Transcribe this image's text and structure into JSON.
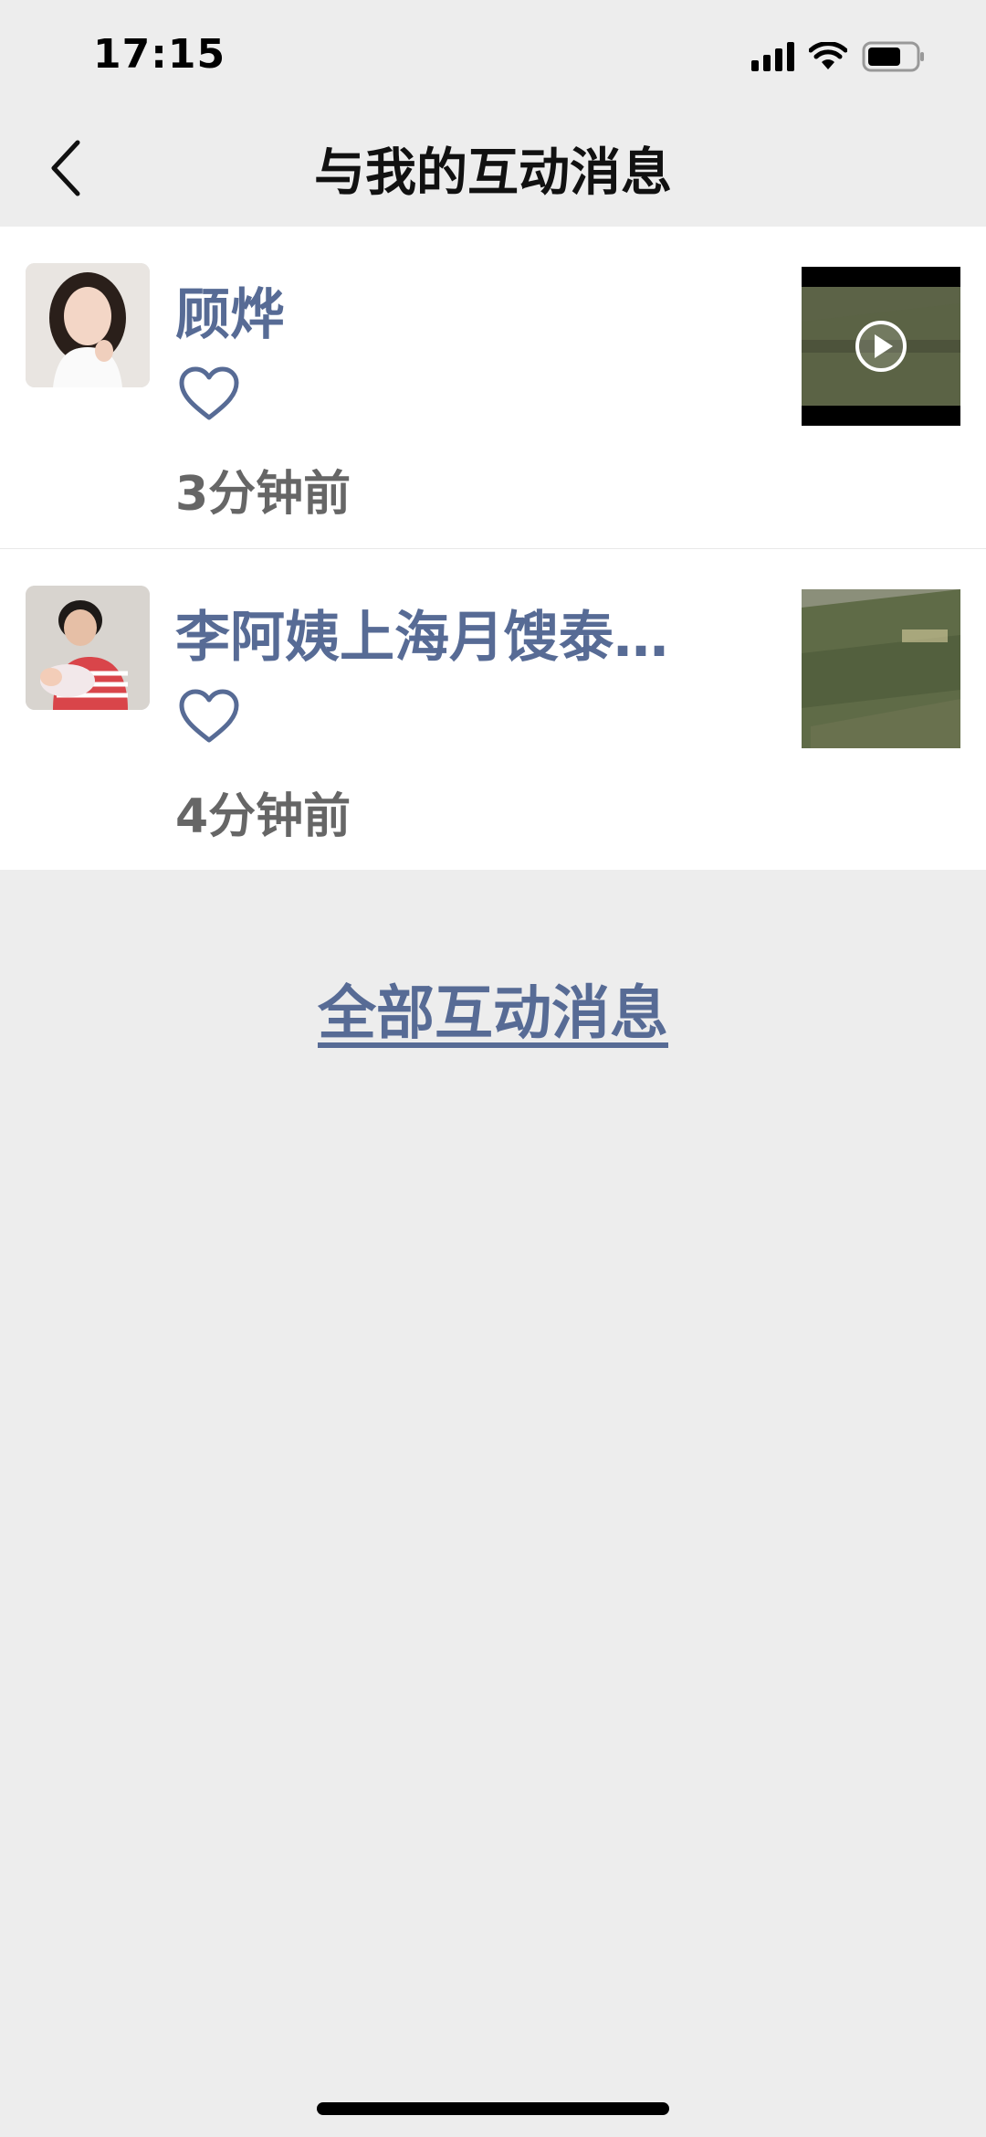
{
  "status_bar": {
    "time": "17:15",
    "battery_level": 0.7
  },
  "nav": {
    "title": "与我的互动消息"
  },
  "items": [
    {
      "name": "顾烨",
      "time": "3分钟前",
      "thumbnail_type": "video"
    },
    {
      "name": "李阿姨上海月馊泰…",
      "time": "4分钟前",
      "thumbnail_type": "image"
    }
  ],
  "all_link": "全部互动消息",
  "colors": {
    "accent": "#576b95",
    "background": "#ededed",
    "secondary_text": "#666666"
  }
}
